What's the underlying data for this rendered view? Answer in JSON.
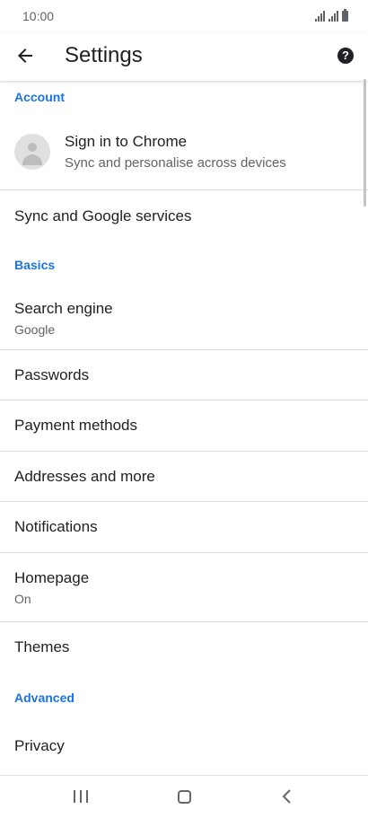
{
  "status_bar": {
    "time": "10:00"
  },
  "app_bar": {
    "title": "Settings",
    "back_icon": "arrow-back-icon",
    "help_icon": "help-icon",
    "help_glyph": "?"
  },
  "sections": {
    "account": "Account",
    "basics": "Basics",
    "advanced": "Advanced"
  },
  "account": {
    "title": "Sign in to Chrome",
    "subtitle": "Sync and personalise across devices"
  },
  "items": {
    "sync": {
      "title": "Sync and Google services"
    },
    "search_engine": {
      "title": "Search engine",
      "subtitle": "Google"
    },
    "passwords": {
      "title": "Passwords"
    },
    "payment_methods": {
      "title": "Payment methods"
    },
    "addresses": {
      "title": "Addresses and more"
    },
    "notifications": {
      "title": "Notifications"
    },
    "homepage": {
      "title": "Homepage",
      "subtitle": "On"
    },
    "themes": {
      "title": "Themes"
    },
    "privacy": {
      "title": "Privacy"
    }
  },
  "colors": {
    "accent": "#1a73e8",
    "text_primary": "#202124",
    "text_secondary": "#5f6368",
    "divider": "#dadce0"
  }
}
